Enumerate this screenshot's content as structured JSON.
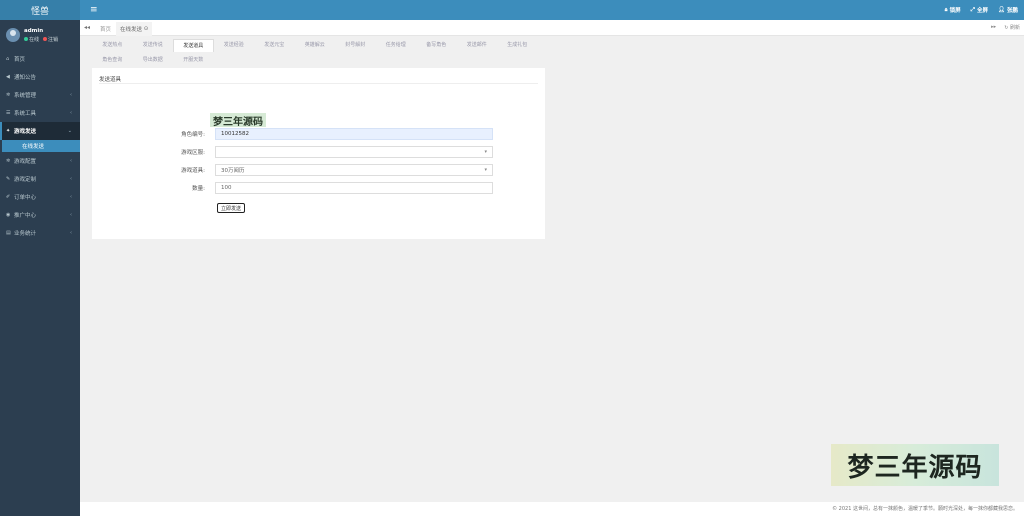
{
  "brand": {
    "title": "怪兽"
  },
  "user": {
    "name": "admin",
    "status_online": "在线",
    "status_logout": "注销"
  },
  "sidebar": {
    "items": [
      {
        "label": "首页",
        "icon": "home-icon"
      },
      {
        "label": "通知公告",
        "icon": "bullhorn-icon"
      },
      {
        "label": "系统管理",
        "icon": "gear-icon"
      },
      {
        "label": "系统工具",
        "icon": "tools-icon"
      },
      {
        "label": "游戏发送",
        "icon": "gamepad-icon"
      },
      {
        "label": "游戏配置",
        "icon": "gear-icon"
      },
      {
        "label": "游戏定制",
        "icon": "edit-icon"
      },
      {
        "label": "订单中心",
        "icon": "pencil-icon"
      },
      {
        "label": "推广中心",
        "icon": "eye-icon"
      },
      {
        "label": "业务统计",
        "icon": "chart-icon"
      }
    ],
    "submenu": {
      "label": "在线发送"
    }
  },
  "topbar": {
    "lock": "锁屏",
    "fullscreen": "全屏",
    "account": "张鹏"
  },
  "tabs": {
    "home": "首页",
    "current": "在线发送",
    "close": "⊙",
    "refresh": "刷新"
  },
  "subnav": {
    "row1": [
      "发送热点",
      "发送传说",
      "发送道具",
      "发送经验",
      "发送元宝",
      "英雄解云",
      "封号解封",
      "任务给理",
      "备写角色",
      "发送邮件",
      "生成礼包"
    ],
    "row2": [
      "角色查询",
      "导出数据",
      "开服天数"
    ],
    "active": "发送道具"
  },
  "panel": {
    "title": "发送道具"
  },
  "form": {
    "role_label": "角色编号:",
    "role_value": "10012582",
    "zone_label": "游戏区服:",
    "zone_value": "",
    "item_label": "游戏道具:",
    "item_value": "30万阅历",
    "qty_label": "数量:",
    "qty_value": "100",
    "submit": "立即发送"
  },
  "watermark": {
    "text": "梦三年源码"
  },
  "footer": {
    "text": "© 2021 这世间，总有一抹颜色，温暖了季节。願时光深处，每一抹你都藏我思恋。"
  },
  "colors": {
    "sidebar": "#2c3e50",
    "topbar": "#3c8dbc",
    "accent": "#3c8dbc"
  }
}
